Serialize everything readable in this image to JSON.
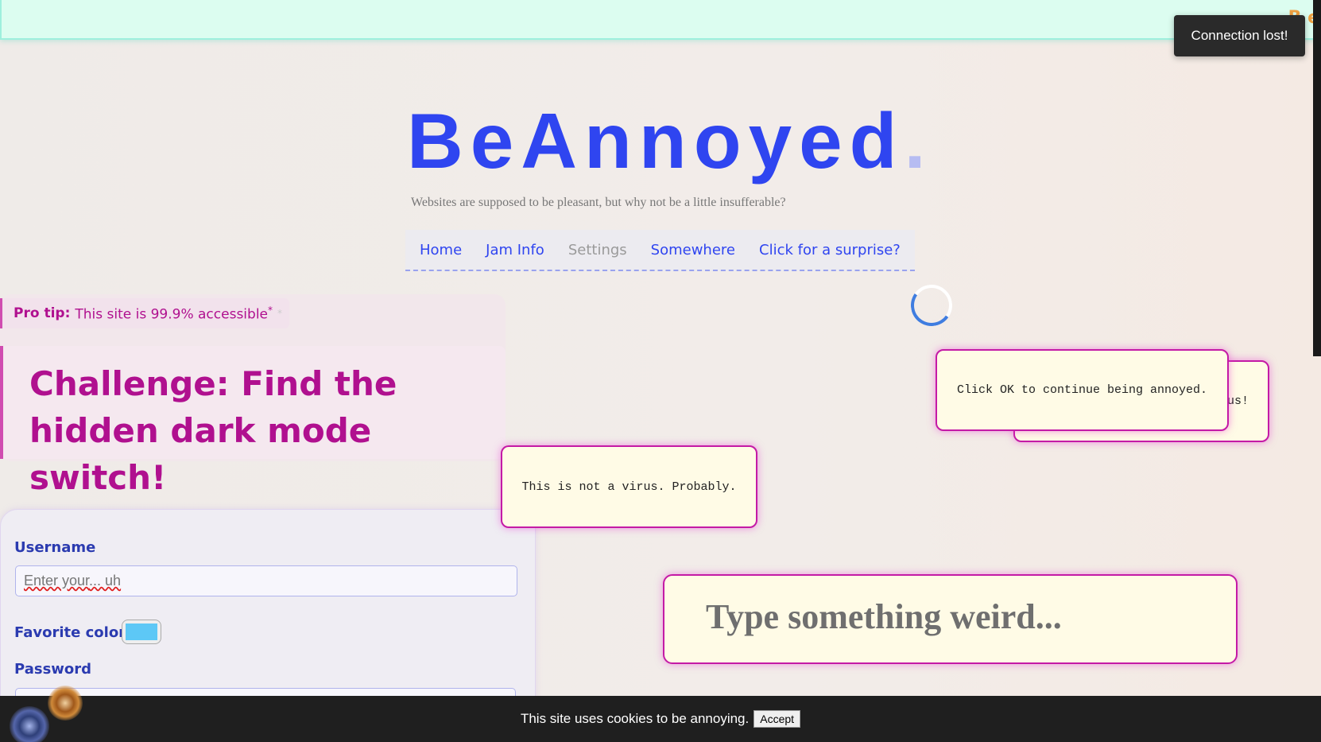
{
  "topbar": {
    "ghost_text": "B e"
  },
  "toast": {
    "text": "Connection lost!"
  },
  "header": {
    "brand": "BeAnnoyed",
    "brand_dot": ".",
    "tagline": "Websites are supposed to be pleasant, but why not be a little insufferable?"
  },
  "nav": {
    "items": [
      "Home",
      "Jam Info",
      "Settings",
      "Somewhere",
      "Click for a surprise?"
    ]
  },
  "tip": {
    "label": "Pro tip:",
    "text": "This site is 99.9% accessible",
    "sup": "*",
    "faint": "*"
  },
  "challenge": {
    "line1": "Challenge: Find the",
    "line2": "hidden dark mode switch!"
  },
  "form": {
    "username_label": "Username",
    "username_placeholder_a": "Enter your",
    "username_placeholder_b": "... uh",
    "color_label": "Favorite color",
    "color_value": "#5dc8f6",
    "password_label": "Password"
  },
  "popups": {
    "back_text": "us!",
    "front_text": "Click OK to continue being annoyed.",
    "virus_text": "This is not a virus. Probably."
  },
  "weird_input": {
    "placeholder": "Type something weird..."
  },
  "cookie": {
    "text": "This site uses cookies to be annoying.",
    "button": "Accept"
  },
  "colors": {
    "brand": "#2f45f0",
    "accent": "#b0108f",
    "popup_border": "#c41aa6"
  }
}
